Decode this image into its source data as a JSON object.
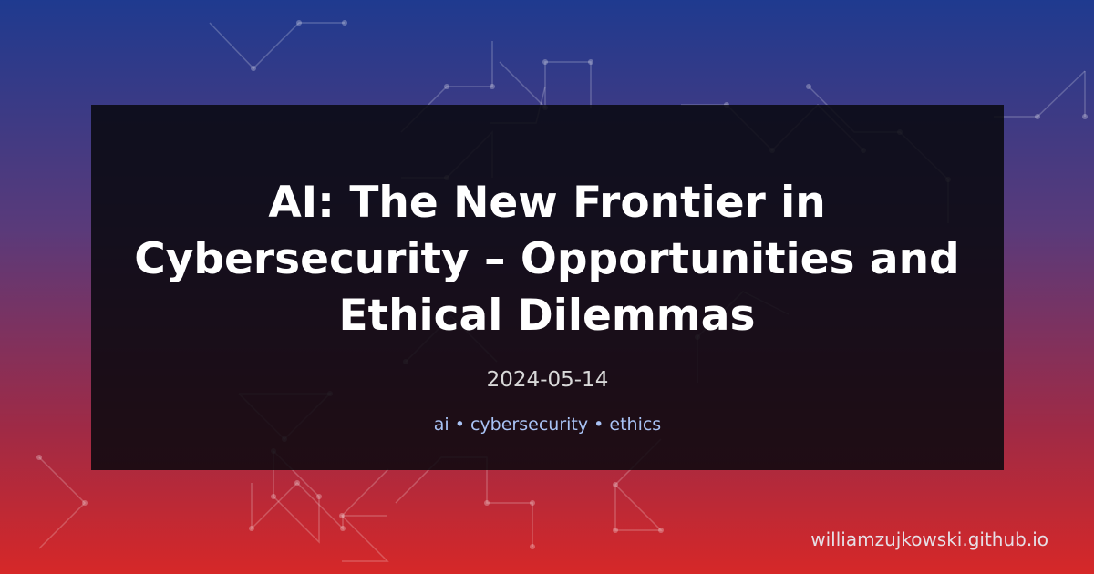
{
  "post": {
    "title": "AI: The New Frontier in Cybersecurity – Opportunities and Ethical Dilemmas",
    "date": "2024-05-14",
    "tags": "ai • cybersecurity • ethics"
  },
  "footer": {
    "site": "williamzujkowski.github.io"
  },
  "colors": {
    "gradient_top": "#1f3a8f",
    "gradient_bottom": "#d62828",
    "panel": "#0b0a12",
    "tags": "#a9c3f5"
  }
}
